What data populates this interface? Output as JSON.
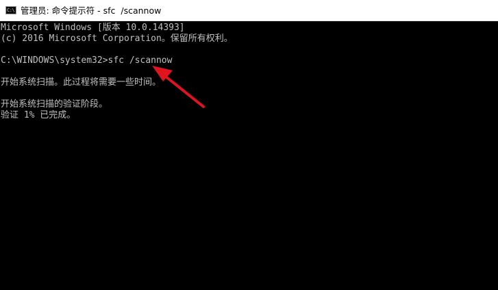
{
  "window": {
    "title": "管理员: 命令提示符 - sfc  /scannow",
    "icon": "cmd-icon",
    "icon_glyph": "C:\\"
  },
  "console": {
    "lines": [
      "Microsoft Windows [版本 10.0.14393]",
      "(c) 2016 Microsoft Corporation。保留所有权利。",
      "",
      "C:\\WINDOWS\\system32>sfc /scannow",
      "",
      "开始系统扫描。此过程将需要一些时间。",
      "",
      "开始系统扫描的验证阶段。",
      "验证 1% 已完成。"
    ]
  },
  "annotation": {
    "icon": "red-arrow-icon",
    "color": "#e0141e"
  },
  "colors": {
    "console_bg": "#000000",
    "console_text": "#c0c0c0",
    "titlebar_bg": "#ffffff"
  }
}
